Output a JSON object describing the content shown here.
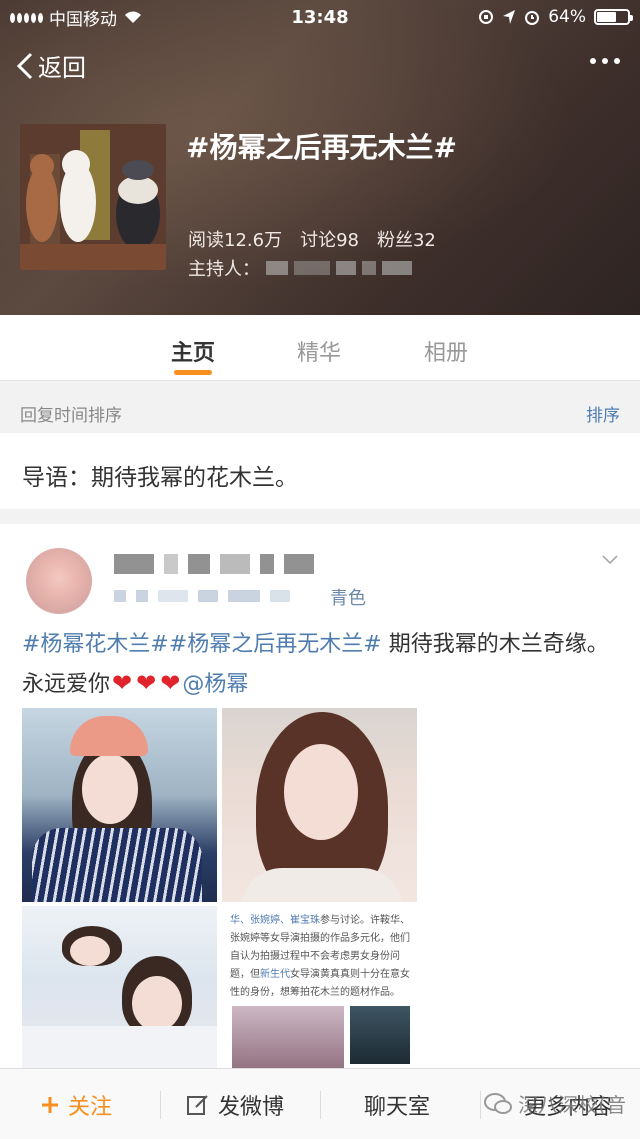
{
  "status_bar": {
    "carrier": "中国移动",
    "time": "13:48",
    "battery": "64%",
    "battery_level": 0.64
  },
  "nav": {
    "back_label": "返回"
  },
  "topic": {
    "title": "#杨幂之后再无木兰#",
    "reads": "阅读12.6万",
    "discussions": "讨论98",
    "fans": "粉丝32",
    "host_label": "主持人："
  },
  "tabs": [
    {
      "label": "主页"
    },
    {
      "label": "精华"
    },
    {
      "label": "相册"
    }
  ],
  "sort": {
    "label": "回复时间排序",
    "button": "排序"
  },
  "intro": "导语：期待我幂的花木兰。",
  "post": {
    "source_suffix": "青色",
    "tag1": "#杨幂花木兰#",
    "tag2": "#杨幂之后再无木兰#",
    "text_part1": " 期待我幂的木兰奇缘。永远爱你",
    "mention": "@杨幂",
    "doc_line1_hl": "华、张婉婷、崔宝珠",
    "doc_line1": "参与讨论。许鞍华、",
    "doc_line2": "张婉婷等女导演拍摄的作品多元化，他们",
    "doc_line3": "自认为拍摄过程中不会考虑男女身份问",
    "doc_line4_a": "题，但",
    "doc_line4_hl": "新生代",
    "doc_line4_b": "女导演黄真真则十分在意女",
    "doc_line5": "性的身份，想筹拍花木兰的题材作品。"
  },
  "bottom_bar": {
    "follow": "关注",
    "post": "发微博",
    "chat": "聊天室",
    "more": "更多内容",
    "watermark": "深八深校(音"
  },
  "colors": {
    "accent": "#f78f1e",
    "link": "#507daf",
    "heart": "#e0242b"
  }
}
